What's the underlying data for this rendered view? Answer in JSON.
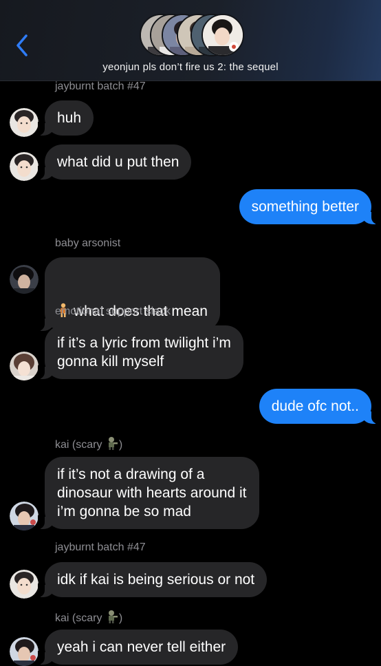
{
  "header": {
    "group_name": "yeonjun pls don’t fire us 2: the sequel",
    "back_icon": "chevron-left-icon",
    "accent": "#2f7cf6"
  },
  "colors": {
    "incoming_bubble": "#262628",
    "outgoing_bubble": "#1e82f8",
    "sender_label": "#8e8e93"
  },
  "messages": [
    {
      "sender": "jayburnt batch #47",
      "text": "huh",
      "direction": "in"
    },
    {
      "text": "what did u put then",
      "direction": "in"
    },
    {
      "text": "something better",
      "direction": "out"
    },
    {
      "sender": "baby arsonist",
      "emoji": "person-emoji",
      "text": "what does that mean",
      "direction": "in"
    },
    {
      "sender": "emotional support slack",
      "text": "if it’s a lyric from twilight i’m\ngonna kill myself",
      "direction": "in"
    },
    {
      "text": "dude ofc not..",
      "direction": "out"
    },
    {
      "sender_prefix": "kai (scary ",
      "sender_suffix": ")",
      "sender_emoji": "zombie-emoji",
      "text": "if it’s not a drawing of a\ndinosaur with hearts around it\ni’m gonna be so mad",
      "direction": "in"
    },
    {
      "sender": "jayburnt batch #47",
      "text": "idk if kai is being serious or not",
      "direction": "in"
    },
    {
      "sender_prefix": "kai (scary ",
      "sender_suffix": ")",
      "sender_emoji": "zombie-emoji",
      "text": "yeah i can never tell either",
      "direction": "in"
    }
  ]
}
